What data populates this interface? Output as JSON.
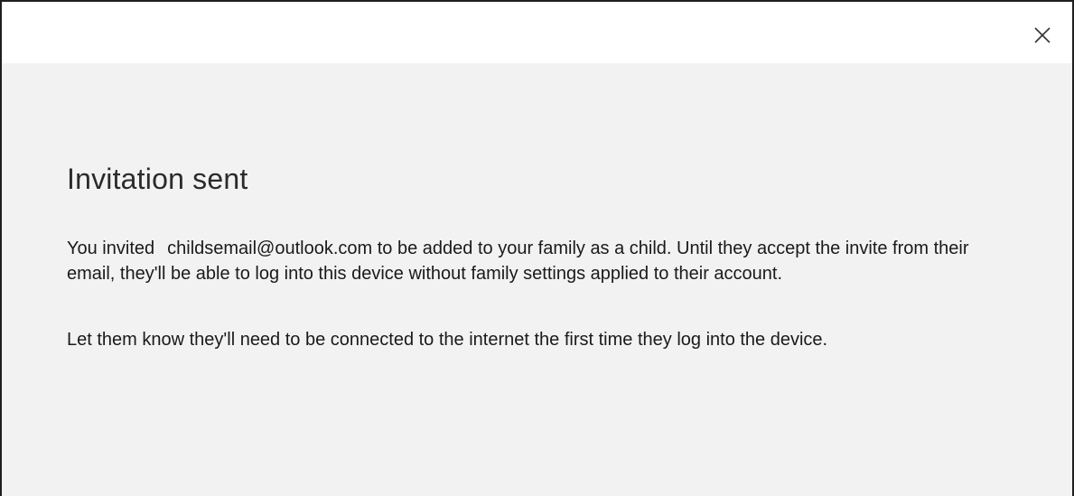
{
  "dialog": {
    "close_icon": "close-icon",
    "heading": "Invitation sent",
    "paragraph1": {
      "prefix": "You invited",
      "email": "childsemail@outlook.com",
      "suffix": " to be added to your family as a child. Until they accept the invite from their email, they'll be able to log into this device without family settings applied to their account."
    },
    "paragraph2": "Let them know they'll need to be connected to the internet the first time they log into the device."
  }
}
